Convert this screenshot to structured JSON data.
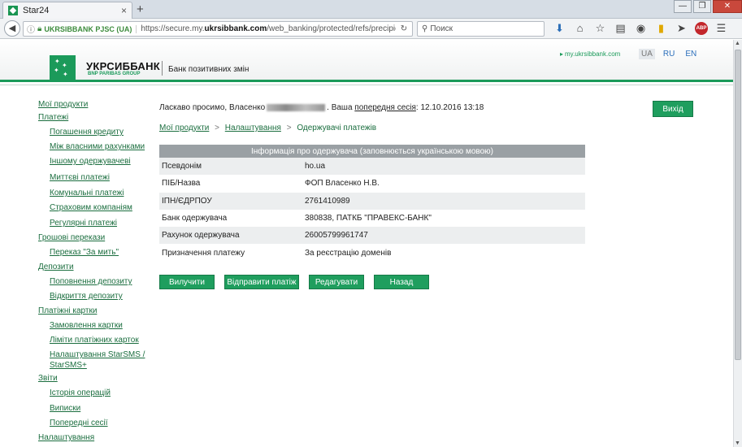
{
  "browser": {
    "tab_title": "Star24",
    "tab_close": "×",
    "new_tab": "+",
    "window_controls": [
      "—",
      "❐",
      "✕"
    ],
    "org_label": "UKRSIBBANK PJSC (UA)",
    "url_prefix": "https://secure.my.",
    "url_domain": "ukrsibbank.com",
    "url_path": "/web_banking/protected/refs/precipients.jsf",
    "search_placeholder": "Поиск",
    "icons": [
      "download-icon",
      "home-icon",
      "bookmark-star-icon",
      "reading-list-icon",
      "pocket-icon",
      "bookmark-icon",
      "send-icon",
      "adblock-icon",
      "menu-icon"
    ]
  },
  "header": {
    "brand": "УКРСИББАНК",
    "brand_sub": "BNP PARIBAS GROUP",
    "slogan": "Банк позитивних змін",
    "top_link": "my.ukrsibbank.com",
    "langs": [
      "UA",
      "RU",
      "EN"
    ],
    "active_lang": "UA"
  },
  "sidebar": {
    "items": [
      {
        "label": "Мої продукти",
        "level": 0
      },
      {
        "label": "Платежі",
        "level": 0
      },
      {
        "label": "Погашення кредиту",
        "level": 1
      },
      {
        "label": "Між власними рахунками",
        "level": 1
      },
      {
        "label": "Іншому одержувачеві",
        "level": 1
      },
      {
        "label": "Миттєві платежі",
        "level": 1
      },
      {
        "label": "Комунальні платежі",
        "level": 1
      },
      {
        "label": "Страховим компаніям",
        "level": 1
      },
      {
        "label": "Регулярні платежі",
        "level": 1
      },
      {
        "label": "Грошові перекази",
        "level": 0
      },
      {
        "label": "Переказ \"За мить\"",
        "level": 1
      },
      {
        "label": "Депозити",
        "level": 0
      },
      {
        "label": "Поповнення депозиту",
        "level": 1
      },
      {
        "label": "Відкриття депозиту",
        "level": 1
      },
      {
        "label": "Платіжні картки",
        "level": 0
      },
      {
        "label": "Замовлення картки",
        "level": 1
      },
      {
        "label": "Ліміти платіжних карток",
        "level": 1
      },
      {
        "label": "Налаштування StarSMS /",
        "level": 1
      },
      {
        "label": "StarSMS+",
        "level": 1
      },
      {
        "label": "Звіти",
        "level": 0
      },
      {
        "label": "Історія операцій",
        "level": 1
      },
      {
        "label": "Виписки",
        "level": 1
      },
      {
        "label": "Попередні сесії",
        "level": 1
      },
      {
        "label": "Налаштування",
        "level": 0
      }
    ]
  },
  "welcome": {
    "prefix": "Ласкаво просимо, Власенко",
    "middle": ". Ваша",
    "session_link": "попередня сесія",
    "suffix": ": 12.10.2016 13:18"
  },
  "exit_button": "Вихід",
  "breadcrumb": {
    "items": [
      "Мої продукти",
      "Налаштування"
    ],
    "current": "Одержувачі платежів",
    "separator": ">"
  },
  "recipient": {
    "title": "Інформація про одержувача (заповнюється українською мовою)",
    "rows": [
      {
        "label": "Псевдонім",
        "value": "ho.ua"
      },
      {
        "label": "ПІБ/Назва",
        "value": "ФОП Власенко Н.В."
      },
      {
        "label": "ІПН/ЄДРПОУ",
        "value": "2761410989"
      },
      {
        "label": "Банк одержувача",
        "value": "380838, ПАТКБ \"ПРАВЕКС-БАНК\""
      },
      {
        "label": "Рахунок одержувача",
        "value": "26005799961747"
      },
      {
        "label": "Призначення платежу",
        "value": "За реєстрацію доменів"
      }
    ]
  },
  "actions": {
    "delete": "Вилучити",
    "send_payment": "Відправити платіж",
    "edit": "Редагувати",
    "back": "Назад"
  },
  "colors": {
    "brand_green": "#1b9a5a",
    "button_green": "#1f9e5e",
    "link_green": "#1b6e3f",
    "table_header": "#9aa0a4"
  }
}
